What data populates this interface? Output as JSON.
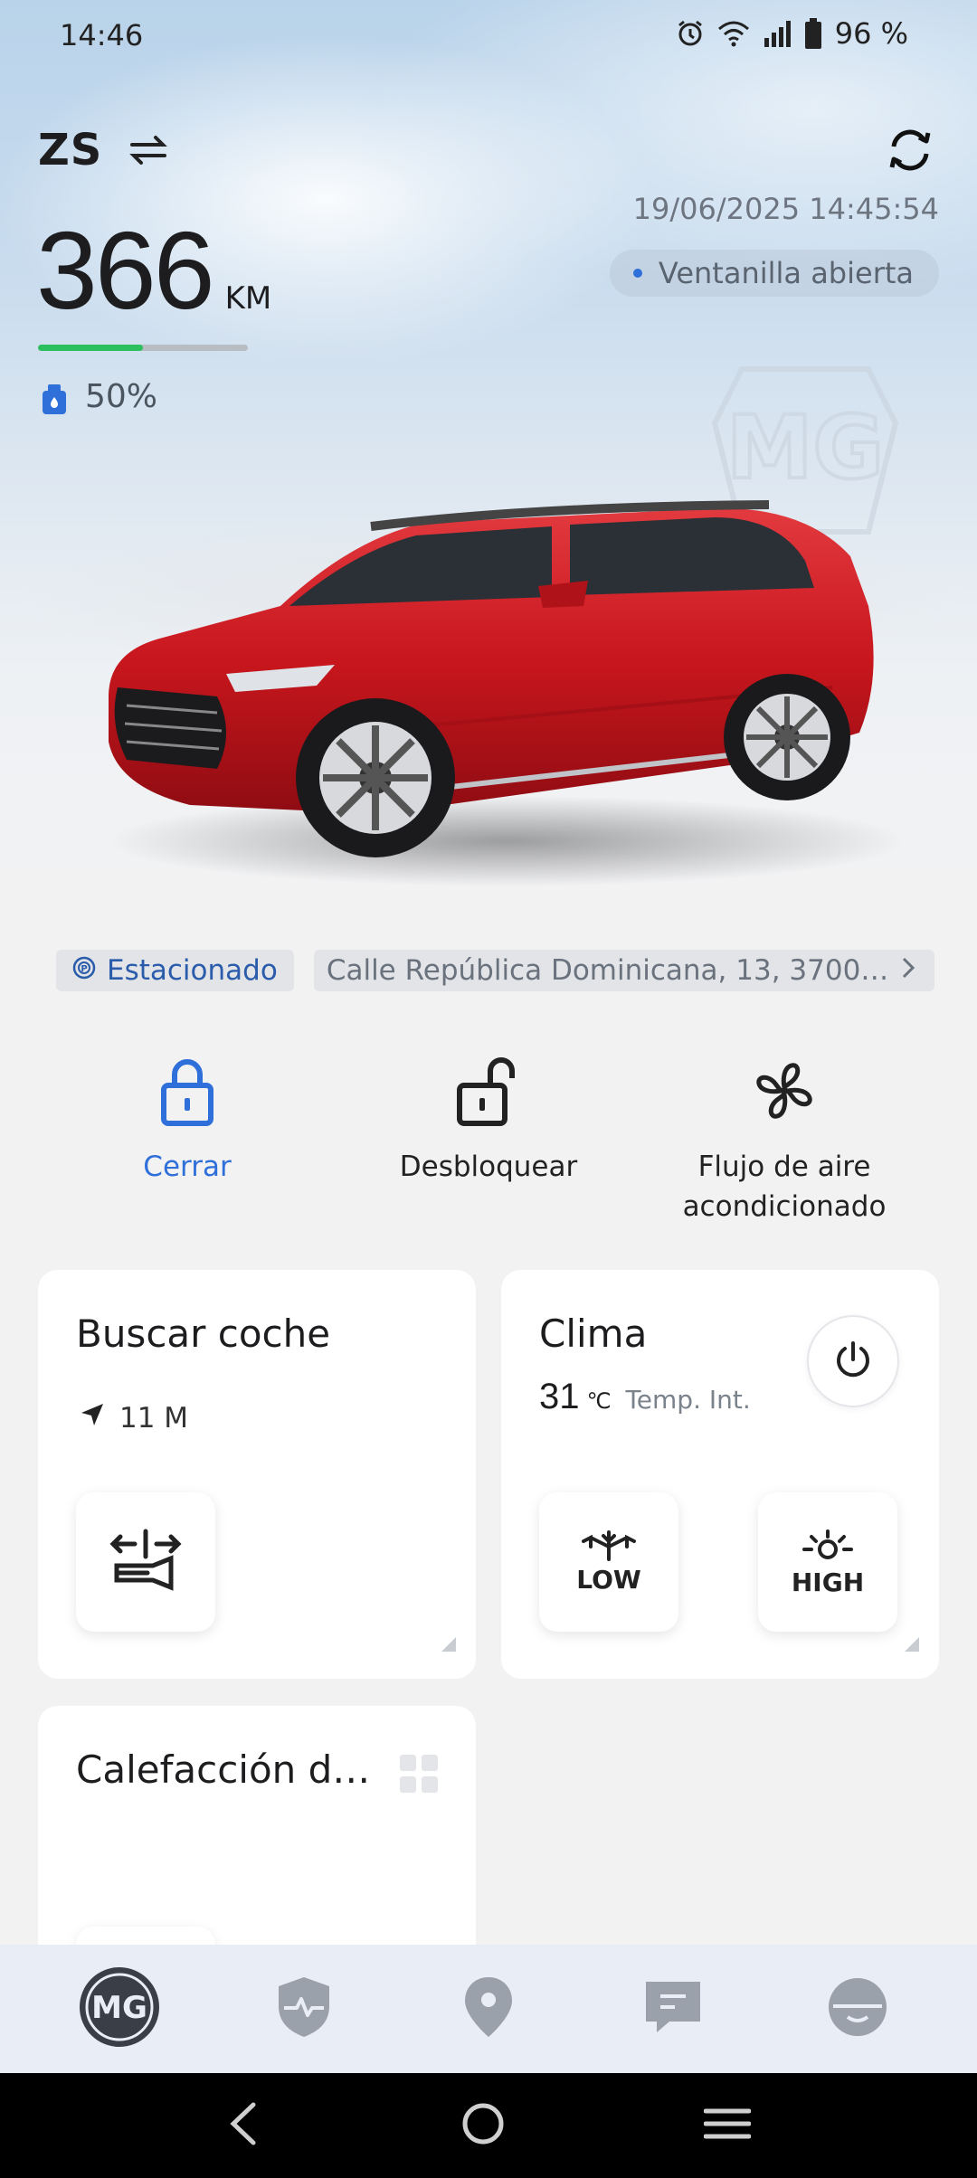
{
  "status_bar": {
    "time": "14:46",
    "battery": "96 %",
    "icons": [
      "alarm-icon",
      "wifi-icon",
      "signal-icon",
      "battery-icon"
    ]
  },
  "vehicle": {
    "model": "ZS",
    "updated_at": "19/06/2025 14:45:54",
    "window_status": "Ventanilla abierta",
    "range_value": "366",
    "range_unit": "KM",
    "range_fill_fraction": 0.5,
    "fuel_level": "50%"
  },
  "location": {
    "status": "Estacionado",
    "address": "Calle República Dominicana, 13, 37003..."
  },
  "actions": [
    {
      "label": "Cerrar",
      "icon": "lock-icon"
    },
    {
      "label": "Desbloquear",
      "icon": "unlock-icon"
    },
    {
      "label": "Flujo de aire acondicionado",
      "icon": "fan-icon"
    }
  ],
  "cards": {
    "find_car": {
      "title": "Buscar coche",
      "distance": "11  M"
    },
    "climate": {
      "title": "Clima",
      "temperature": "31",
      "unit": "℃",
      "label": "Temp. Int.",
      "low_label": "LOW",
      "high_label": "HIGH"
    },
    "heating": {
      "title": "Calefacción de..."
    }
  },
  "bottom_nav": [
    "mg-home",
    "vehicle-health",
    "location",
    "messages",
    "profile"
  ],
  "colors": {
    "accent": "#2e6fd9",
    "range_bar": "#2cbf5d",
    "car": "#c8161d"
  }
}
